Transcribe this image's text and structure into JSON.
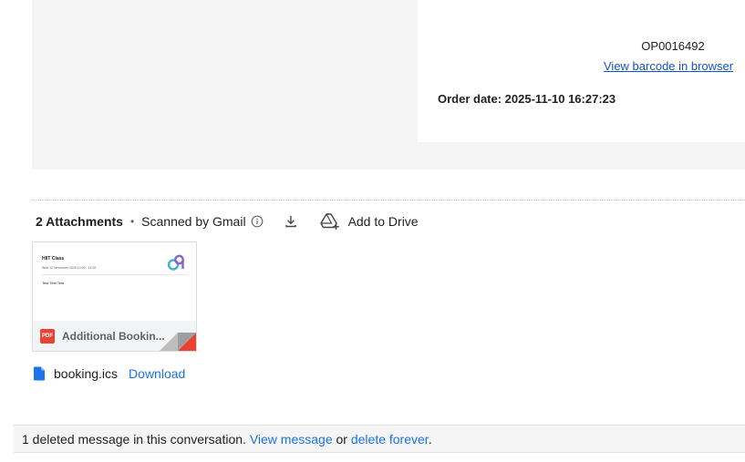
{
  "email_body": {
    "order_number": "OP0016492",
    "barcode_link": "View barcode in browser",
    "order_date": "Order date: 2025-11-10 16:27:23"
  },
  "attachments": {
    "count_label": "2 Attachments",
    "separator": "•",
    "scanned_label": "Scanned by Gmail",
    "add_to_drive": "Add to Drive",
    "card": {
      "thumbnail_title": "HIIT Class",
      "thumbnail_subtitle": "Wed 12 November 2025 10:00 - 11:00",
      "thumbnail_body": "Test Test Test",
      "badge": "PDF",
      "file_name": "Additional Bookin..."
    },
    "ics": {
      "file_name": "booking.ics",
      "download_label": "Download"
    }
  },
  "deleted_notice": {
    "text": "1 deleted message in this conversation. ",
    "view_link": "View message",
    "or_text": " or ",
    "delete_link": "delete forever",
    "end": "."
  },
  "colors": {
    "link": "#1a73e8",
    "pdf_red": "#ea4335",
    "panel_gray": "#f5f5f5"
  }
}
